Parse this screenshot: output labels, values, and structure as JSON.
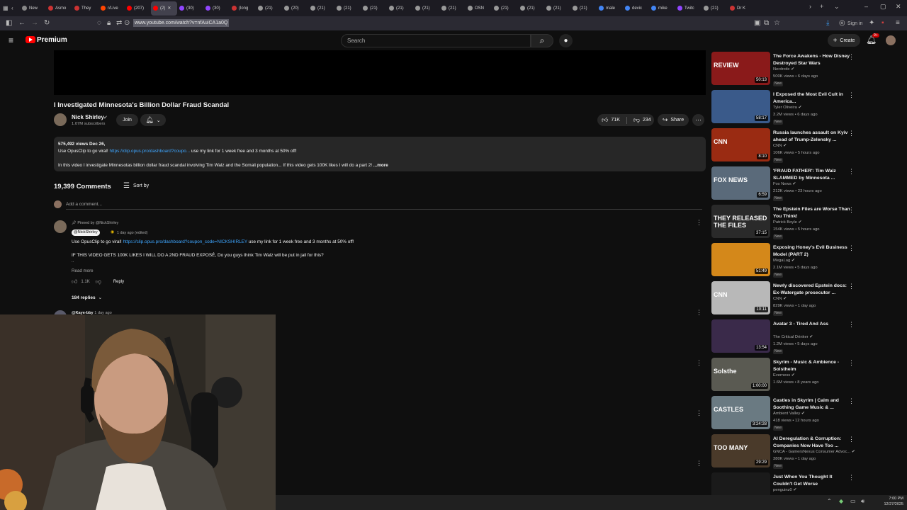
{
  "browser": {
    "tabs": [
      {
        "label": "New",
        "color": "#888888"
      },
      {
        "label": "Asmo",
        "color": "#cc3333"
      },
      {
        "label": "They",
        "color": "#cc3333"
      },
      {
        "label": "r/Live",
        "color": "#ff4500"
      },
      {
        "label": "(207)",
        "color": "#ff0000"
      },
      {
        "label": "(2)",
        "color": "#ff0000",
        "active": true
      },
      {
        "label": "(30)",
        "color": "#9146ff"
      },
      {
        "label": "(30)",
        "color": "#9146ff"
      },
      {
        "label": "(long",
        "color": "#cc3333"
      },
      {
        "label": "(21)",
        "color": "#999999"
      },
      {
        "label": "(20)",
        "color": "#999999"
      },
      {
        "label": "(21)",
        "color": "#999999"
      },
      {
        "label": "(21)",
        "color": "#999999"
      },
      {
        "label": "(21)",
        "color": "#999999"
      },
      {
        "label": "(21)",
        "color": "#999999"
      },
      {
        "label": "(21)",
        "color": "#999999"
      },
      {
        "label": "(21)",
        "color": "#999999"
      },
      {
        "label": "OSN",
        "color": "#999999"
      },
      {
        "label": "(21)",
        "color": "#999999"
      },
      {
        "label": "(21)",
        "color": "#999999"
      },
      {
        "label": "(21)",
        "color": "#999999"
      },
      {
        "label": "(21)",
        "color": "#999999"
      },
      {
        "label": "male",
        "color": "#4285f4"
      },
      {
        "label": "devic",
        "color": "#4285f4"
      },
      {
        "label": "mike",
        "color": "#4285f4"
      },
      {
        "label": "Twitc",
        "color": "#9146ff"
      },
      {
        "label": "(21)",
        "color": "#999999"
      },
      {
        "label": "Dr K",
        "color": "#cc3333"
      }
    ],
    "url": "www.youtube.com/watch?v=nfAuiCA1a0Q",
    "sign_in": "Sign in"
  },
  "youtube": {
    "logo_text": "Premium",
    "search_placeholder": "Search",
    "create_label": "Create",
    "notification_count": "9+"
  },
  "video": {
    "title": "I Investigated Minnesota's Billion Dollar Fraud Scandal",
    "channel": "Nick Shirley",
    "subscribers": "1.07M subscribers",
    "join_label": "Join",
    "likes": "71K",
    "dislikes": "234",
    "share_label": "Share"
  },
  "description": {
    "stats": "575,492 views  Dec 26,",
    "line1_prefix": "Use OpusClip to go viral! ",
    "line1_link": "https://clip.opus.pro/dashboard?coupo...",
    "line1_suffix": " use my link for 1 week free and 3 months at 50% off!",
    "line2": "In this video I investigate Minnesotas billion dollar fraud scandal involving Tim Walz and the Somali population... If this video gets 100K likes I will do a part 2!",
    "more_label": "...more"
  },
  "comments": {
    "count_label": "19,399 Comments",
    "sort_label": "Sort by",
    "add_placeholder": "Add a comment...",
    "pinned_label": "Pinned by @NickShirley",
    "author": "@NickShirley",
    "time": "1 day ago (edited)",
    "text1_prefix": "Use OpusClip to go viral! ",
    "text1_link": "https://clip.opus.pro/dashboard?coupon_code=NICKSHIRLEY",
    "text1_suffix": " use my link for 1 week free and 3 months at 50% off!",
    "text2": "IF THIS VIDEO GETS 100K LIKES I WILL DO A 2ND FRAUD EXPOSÉ, Do you guys think Tim Walz will be put in jail for this?",
    "read_more": "Read more",
    "likes": "1.1K",
    "reply_label": "Reply",
    "replies_label": "184 replies",
    "next_author": "@Kaye-bby",
    "next_time": "1 day ago"
  },
  "recommendations": [
    {
      "title": "The Force Awakens - How Disney Destroyed Star Wars",
      "channel": "Nerdrotic",
      "meta": "500K views • 6 days ago",
      "badge": "New",
      "duration": "50:13",
      "thumb_text": "REVIEW",
      "thumb_color": "#8a1a1a"
    },
    {
      "title": "I Exposed the Most Evil Cult in America...",
      "channel": "Tyler Oliveira",
      "meta": "3.2M views • 6 days ago",
      "badge": "New",
      "duration": "58:17",
      "thumb_text": "",
      "thumb_color": "#3a5a8a"
    },
    {
      "title": "Russia launches assault on Kyiv ahead of Trump-Zelensky ...",
      "channel": "CNN",
      "meta": "106K views • 5 hours ago",
      "badge": "New",
      "duration": "8:10",
      "thumb_text": "CNN",
      "thumb_color": "#9a2b12"
    },
    {
      "title": "'FRAUD FATHER': Tim Walz SLAMMED by Minnesota ...",
      "channel": "Fox News",
      "meta": "212K views • 23 hours ago",
      "badge": "New",
      "duration": "6:59",
      "thumb_text": "FOX NEWS",
      "thumb_color": "#5a6a7a"
    },
    {
      "title": "The Epstein Files are Worse Than You Think!",
      "channel": "Patrick Boyle",
      "meta": "154K views • 5 hours ago",
      "badge": "New",
      "duration": "37:15",
      "thumb_text": "THEY RELEASED THE FILES",
      "thumb_color": "#2a2a2a"
    },
    {
      "title": "Exposing Honey's Evil Business Model (PART 2)",
      "channel": "MegaLag",
      "meta": "2.1M views • 5 days ago",
      "badge": "New",
      "duration": "51:49",
      "thumb_text": "",
      "thumb_color": "#d4881a"
    },
    {
      "title": "Newly discovered Epstein docs: Ex-Watergate prosecutor ...",
      "channel": "CNN",
      "meta": "829K views • 1 day ago",
      "badge": "New",
      "duration": "10:11",
      "thumb_text": "CNN",
      "thumb_color": "#b8b8b8"
    },
    {
      "title": "Avatar 3 - Tired And Ass",
      "channel": "The Critical Drinker",
      "meta": "1.2M views • 5 days ago",
      "badge": "New",
      "duration": "13:54",
      "thumb_text": "",
      "thumb_color": "#3a2a4a"
    },
    {
      "title": "Skyrim - Music & Ambience - Solstheim",
      "channel": "Everness",
      "meta": "1.6M views • 8 years ago",
      "badge": "",
      "duration": "1:00:00",
      "thumb_text": "Solsthe",
      "thumb_color": "#5a5a52"
    },
    {
      "title": "Castles in Skyrim | Calm and Soothing Game Music & ...",
      "channel": "Ambient Valley",
      "meta": "418 views • 12 hours ago",
      "badge": "New",
      "duration": "3:24:28",
      "thumb_text": "CASTLES",
      "thumb_color": "#6a7a82"
    },
    {
      "title": "AI Deregulation & Corruption: Companies Now Have Too ...",
      "channel": "GNCA - GamersNexus Consumer Advoc...",
      "meta": "380K views • 1 day ago",
      "badge": "New",
      "duration": "29:29",
      "thumb_text": "TOO MANY",
      "thumb_color": "#4a3a2a"
    },
    {
      "title": "Just When You Thought It Couldn't Get Worse",
      "channel": "penguinz0",
      "meta": "",
      "badge": "",
      "duration": "",
      "thumb_text": "",
      "thumb_color": "#1a1a1a"
    }
  ],
  "taskbar": {
    "time": "7:00 PM",
    "date": "12/27/2025"
  }
}
